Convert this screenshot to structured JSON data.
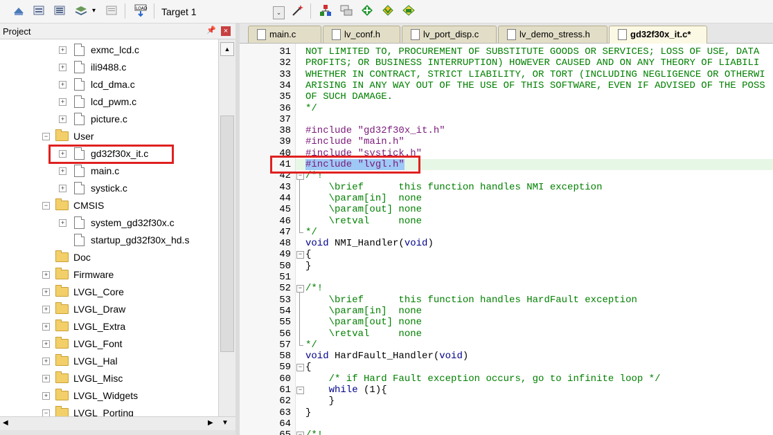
{
  "toolbar": {
    "target_label": "Target 1",
    "icons": [
      "build-icon",
      "rebuild-icon",
      "batch-build-icon",
      "download-icon",
      "translate-icon",
      "load-icon",
      "target-options-icon",
      "manage-components-icon",
      "select-packs-icon",
      "run-env-icon",
      "pack-installer-icon",
      "magic-wand-icon"
    ]
  },
  "project": {
    "title": "Project",
    "tree": [
      {
        "label": "exmc_lcd.c",
        "type": "file",
        "expander": "+",
        "level": 2
      },
      {
        "label": "ili9488.c",
        "type": "file",
        "expander": "+",
        "level": 2
      },
      {
        "label": "lcd_dma.c",
        "type": "file",
        "expander": "+",
        "level": 2
      },
      {
        "label": "lcd_pwm.c",
        "type": "file",
        "expander": "+",
        "level": 2
      },
      {
        "label": "picture.c",
        "type": "file",
        "expander": "+",
        "level": 2
      },
      {
        "label": "User",
        "type": "folder",
        "expander": "−",
        "level": 1
      },
      {
        "label": "gd32f30x_it.c",
        "type": "file",
        "expander": "+",
        "level": 2,
        "highlight": true
      },
      {
        "label": "main.c",
        "type": "file",
        "expander": "+",
        "level": 2
      },
      {
        "label": "systick.c",
        "type": "file",
        "expander": "+",
        "level": 2
      },
      {
        "label": "CMSIS",
        "type": "folder",
        "expander": "−",
        "level": 1
      },
      {
        "label": "system_gd32f30x.c",
        "type": "file",
        "expander": "+",
        "level": 2
      },
      {
        "label": "startup_gd32f30x_hd.s",
        "type": "file",
        "expander": "",
        "level": 2
      },
      {
        "label": "Doc",
        "type": "folder",
        "expander": "",
        "level": 1
      },
      {
        "label": "Firmware",
        "type": "folder",
        "expander": "+",
        "level": 1
      },
      {
        "label": "LVGL_Core",
        "type": "folder",
        "expander": "+",
        "level": 1
      },
      {
        "label": "LVGL_Draw",
        "type": "folder",
        "expander": "+",
        "level": 1
      },
      {
        "label": "LVGL_Extra",
        "type": "folder",
        "expander": "+",
        "level": 1
      },
      {
        "label": "LVGL_Font",
        "type": "folder",
        "expander": "+",
        "level": 1
      },
      {
        "label": "LVGL_Hal",
        "type": "folder",
        "expander": "+",
        "level": 1
      },
      {
        "label": "LVGL_Misc",
        "type": "folder",
        "expander": "+",
        "level": 1
      },
      {
        "label": "LVGL_Widgets",
        "type": "folder",
        "expander": "+",
        "level": 1
      },
      {
        "label": "LVGL_Porting",
        "type": "folder",
        "expander": "−",
        "level": 1
      }
    ]
  },
  "tabs": [
    {
      "label": "main.c",
      "active": false
    },
    {
      "label": "lv_conf.h",
      "active": false
    },
    {
      "label": "lv_port_disp.c",
      "active": false
    },
    {
      "label": "lv_demo_stress.h",
      "active": false
    },
    {
      "label": "gd32f30x_it.c*",
      "active": true
    }
  ],
  "editor": {
    "lines": [
      {
        "n": "31",
        "fold": "",
        "parts": [
          [
            "cmt",
            "NOT LIMITED TO, PROCUREMENT OF SUBSTITUTE GOODS OR SERVICES; LOSS OF USE, DATA"
          ]
        ]
      },
      {
        "n": "32",
        "fold": "",
        "parts": [
          [
            "cmt",
            "PROFITS; OR BUSINESS INTERRUPTION) HOWEVER CAUSED AND ON ANY THEORY OF LIABILI"
          ]
        ]
      },
      {
        "n": "33",
        "fold": "",
        "parts": [
          [
            "cmt",
            "WHETHER IN CONTRACT, STRICT LIABILITY, OR TORT (INCLUDING NEGLIGENCE OR OTHERWI"
          ]
        ]
      },
      {
        "n": "34",
        "fold": "",
        "parts": [
          [
            "cmt",
            "ARISING IN ANY WAY OUT OF THE USE OF THIS SOFTWARE, EVEN IF ADVISED OF THE POSS"
          ]
        ]
      },
      {
        "n": "35",
        "fold": "",
        "parts": [
          [
            "cmt",
            "OF SUCH DAMAGE."
          ]
        ]
      },
      {
        "n": "36",
        "fold": "",
        "parts": [
          [
            "cmt",
            "*/"
          ]
        ]
      },
      {
        "n": "37",
        "fold": "",
        "parts": []
      },
      {
        "n": "38",
        "fold": "",
        "parts": [
          [
            "pre",
            "#include "
          ],
          [
            "str",
            "\"gd32f30x_it.h\""
          ]
        ]
      },
      {
        "n": "39",
        "fold": "",
        "parts": [
          [
            "pre",
            "#include "
          ],
          [
            "str",
            "\"main.h\""
          ]
        ]
      },
      {
        "n": "40",
        "fold": "",
        "parts": [
          [
            "pre",
            "#include "
          ],
          [
            "str",
            "\"systick.h\""
          ]
        ]
      },
      {
        "n": "41",
        "fold": "",
        "parts": [
          [
            "pre sel",
            "#include "
          ],
          [
            "str sel",
            "\"lvgl.h\""
          ]
        ],
        "current": true
      },
      {
        "n": "42",
        "fold": "box",
        "parts": [
          [
            "cmt",
            "/*!"
          ]
        ]
      },
      {
        "n": "43",
        "fold": "",
        "parts": [
          [
            "cmt",
            "    \\brief      this function handles NMI exception"
          ]
        ]
      },
      {
        "n": "44",
        "fold": "",
        "parts": [
          [
            "cmt",
            "    \\param[in]  none"
          ]
        ]
      },
      {
        "n": "45",
        "fold": "",
        "parts": [
          [
            "cmt",
            "    \\param[out] none"
          ]
        ]
      },
      {
        "n": "46",
        "fold": "",
        "parts": [
          [
            "cmt",
            "    \\retval     none"
          ]
        ]
      },
      {
        "n": "47",
        "fold": "end",
        "parts": [
          [
            "cmt",
            "*/"
          ]
        ]
      },
      {
        "n": "48",
        "fold": "",
        "parts": [
          [
            "kw",
            "void "
          ],
          [
            "plain",
            "NMI_Handler("
          ],
          [
            "kw",
            "void"
          ],
          [
            "plain",
            ")"
          ]
        ]
      },
      {
        "n": "49",
        "fold": "box",
        "parts": [
          [
            "plain",
            "{"
          ]
        ]
      },
      {
        "n": "50",
        "fold": "",
        "parts": [
          [
            "plain",
            "}"
          ]
        ]
      },
      {
        "n": "51",
        "fold": "",
        "parts": []
      },
      {
        "n": "52",
        "fold": "box",
        "parts": [
          [
            "cmt",
            "/*!"
          ]
        ]
      },
      {
        "n": "53",
        "fold": "",
        "parts": [
          [
            "cmt",
            "    \\brief      this function handles HardFault exception"
          ]
        ]
      },
      {
        "n": "54",
        "fold": "",
        "parts": [
          [
            "cmt",
            "    \\param[in]  none"
          ]
        ]
      },
      {
        "n": "55",
        "fold": "",
        "parts": [
          [
            "cmt",
            "    \\param[out] none"
          ]
        ]
      },
      {
        "n": "56",
        "fold": "",
        "parts": [
          [
            "cmt",
            "    \\retval     none"
          ]
        ]
      },
      {
        "n": "57",
        "fold": "end",
        "parts": [
          [
            "cmt",
            "*/"
          ]
        ]
      },
      {
        "n": "58",
        "fold": "",
        "parts": [
          [
            "kw",
            "void "
          ],
          [
            "plain",
            "HardFault_Handler("
          ],
          [
            "kw",
            "void"
          ],
          [
            "plain",
            ")"
          ]
        ]
      },
      {
        "n": "59",
        "fold": "box",
        "parts": [
          [
            "plain",
            "{"
          ]
        ]
      },
      {
        "n": "60",
        "fold": "",
        "parts": [
          [
            "cmt",
            "    /* if Hard Fault exception occurs, go to infinite loop */"
          ]
        ]
      },
      {
        "n": "61",
        "fold": "box",
        "parts": [
          [
            "kw",
            "    while "
          ],
          [
            "plain",
            "(1){"
          ]
        ]
      },
      {
        "n": "62",
        "fold": "",
        "parts": [
          [
            "plain",
            "    }"
          ]
        ]
      },
      {
        "n": "63",
        "fold": "",
        "parts": [
          [
            "plain",
            "}"
          ]
        ]
      },
      {
        "n": "64",
        "fold": "",
        "parts": []
      },
      {
        "n": "65",
        "fold": "box",
        "parts": [
          [
            "cmt",
            "/*!"
          ]
        ]
      }
    ]
  },
  "colors": {
    "highlight_box": "#e02020",
    "selection": "#9ec8f5",
    "current_line": "#e6f7e6"
  }
}
